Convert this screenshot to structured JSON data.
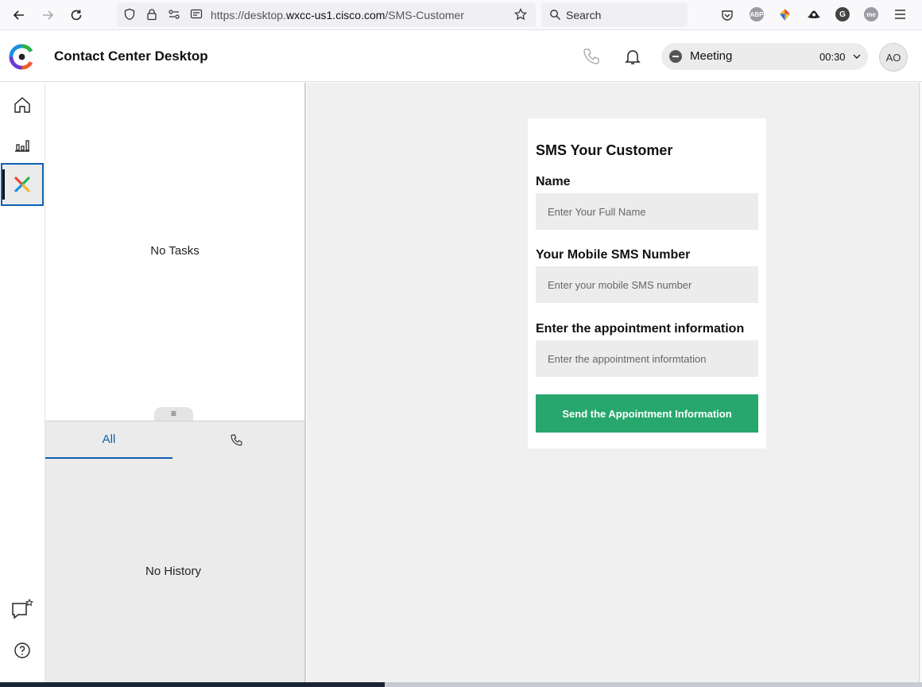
{
  "browser": {
    "url_prefix": "https://desktop.",
    "url_host": "wxcc-us1.cisco.com",
    "url_path": "/SMS-Customer",
    "search_placeholder": "Search",
    "extensions": [
      {
        "name": "ABP",
        "color": "#9b9ba3"
      },
      {
        "name": "G",
        "color": "#444444"
      },
      {
        "name": "me",
        "color": "#9b9ba3"
      }
    ]
  },
  "header": {
    "title": "Contact Center Desktop",
    "state_label": "Meeting",
    "state_timer": "00:30",
    "avatar_initials": "AO"
  },
  "tasks": {
    "empty_text": "No Tasks",
    "drag_handle_glyph": "≡"
  },
  "history": {
    "tabs": [
      {
        "label": "All",
        "active": true
      },
      {
        "label": "",
        "icon": "phone-icon",
        "active": false
      }
    ],
    "empty_text": "No History"
  },
  "form": {
    "title": "SMS Your Customer",
    "fields": [
      {
        "label": "Name",
        "placeholder": "Enter Your Full Name"
      },
      {
        "label": "Your Mobile SMS Number",
        "placeholder": "Enter your mobile SMS number"
      },
      {
        "label": "Enter the appointment information",
        "placeholder": "Enter the appointment informtation"
      }
    ],
    "submit_label": "Send the Appointment Information"
  },
  "colors": {
    "accent": "#0d5fb3",
    "submit_button": "#27a76e",
    "main_background": "#f0f0f0"
  }
}
